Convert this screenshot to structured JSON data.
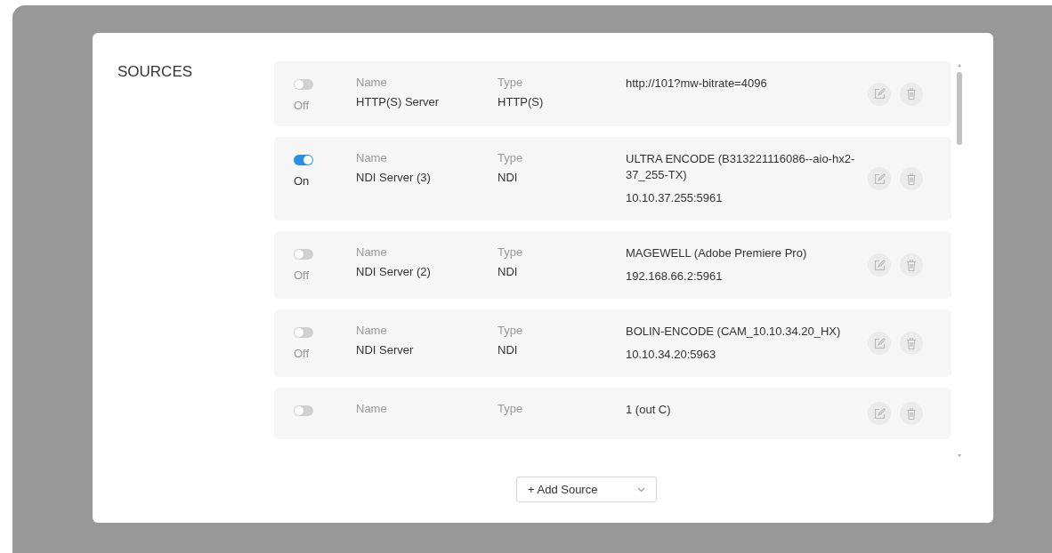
{
  "section_title": "SOURCES",
  "sources": [
    {
      "on": false,
      "state_label": "Off",
      "name_label": "Name",
      "name": "HTTP(S) Server",
      "type_label": "Type",
      "type": "HTTP(S)",
      "details": [
        "http://101?mw-bitrate=4096"
      ]
    },
    {
      "on": true,
      "state_label": "On",
      "name_label": "Name",
      "name": "NDI Server (3)",
      "type_label": "Type",
      "type": "NDI",
      "details": [
        "ULTRA ENCODE (B313221116086--aio-hx2-37_255-TX)",
        "10.10.37.255:5961"
      ]
    },
    {
      "on": false,
      "state_label": "Off",
      "name_label": "Name",
      "name": "NDI Server (2)",
      "type_label": "Type",
      "type": "NDI",
      "details": [
        "MAGEWELL (Adobe Premiere Pro)",
        "192.168.66.2:5961"
      ]
    },
    {
      "on": false,
      "state_label": "Off",
      "name_label": "Name",
      "name": "NDI Server",
      "type_label": "Type",
      "type": "NDI",
      "details": [
        "BOLIN-ENCODE (CAM_10.10.34.20_HX)",
        "10.10.34.20:5963"
      ]
    },
    {
      "on": false,
      "name_label": "Name",
      "type_label": "Type",
      "details": [
        "1 (out C)"
      ]
    }
  ],
  "add_button": {
    "label": "+ Add Source"
  }
}
